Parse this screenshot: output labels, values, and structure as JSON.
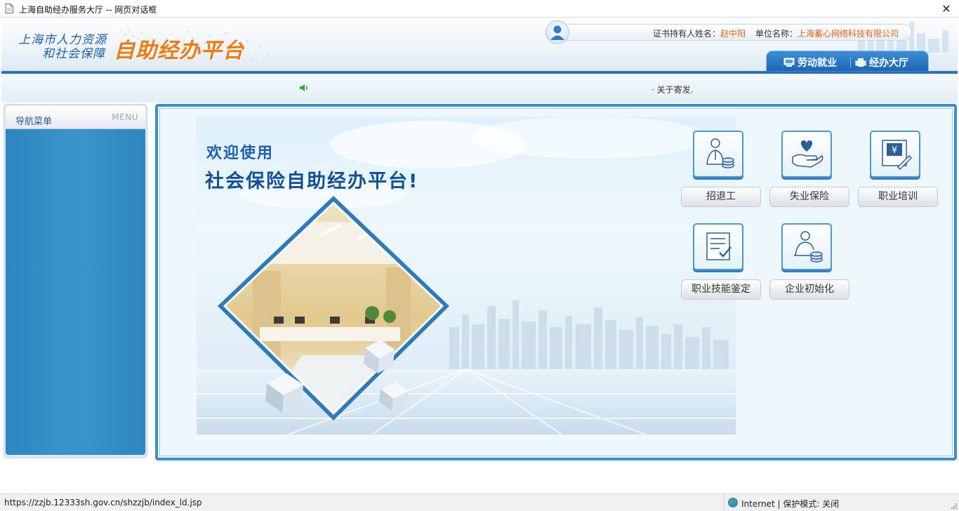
{
  "window": {
    "title": "上海自助经办服务大厅 -- 网页对话框",
    "close_glyph": "✕"
  },
  "header": {
    "logo_line1": "上海市人力资源",
    "logo_line2": "和社会保障",
    "logo_main": "自助经办平台",
    "user": {
      "holder_label": "证书持有人姓名：",
      "holder_name": "赵中阳",
      "unit_label": "单位名称：",
      "unit_name": "上海蓄心网络科技有限公司"
    },
    "tabs": [
      {
        "label": "劳动就业",
        "icon": "monitor-icon"
      },
      {
        "label": "经办大厅",
        "icon": "printer-icon"
      }
    ]
  },
  "notice": {
    "text": "· 关于寄发.",
    "icon": "speaker-icon"
  },
  "sidebar": {
    "title": "导航菜单",
    "title_en": "MENU"
  },
  "banner": {
    "line1": "欢迎使用",
    "line2": "社会保险自助经办平台!"
  },
  "services": [
    {
      "label": "招退工",
      "icon": "worker-coins-icon"
    },
    {
      "label": "失业保险",
      "icon": "heart-hand-icon"
    },
    {
      "label": "职业培训",
      "icon": "yuan-document-icon"
    },
    {
      "label": "职业技能鉴定",
      "icon": "checklist-icon"
    },
    {
      "label": "企业初始化",
      "icon": "person-coins-icon"
    }
  ],
  "statusbar": {
    "url": "https://zzjb.12333sh.gov.cn/shzzjb/index_ld.jsp",
    "zone": "Internet | 保护模式: 关闭",
    "zone_icon": "globe-icon"
  },
  "colors": {
    "accent_blue": "#1d62b3",
    "logo_orange": "#f07a12",
    "highlight_orange": "#e2631a",
    "sidebar_blue": "#3b94c9"
  }
}
